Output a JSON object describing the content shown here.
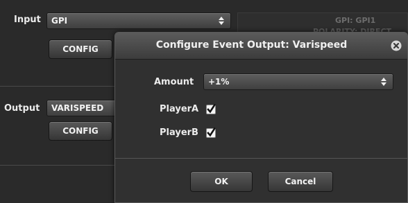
{
  "input": {
    "label": "Input",
    "value": "GPI",
    "config_label": "CONFIG",
    "info_line1": "GPI: GPI1",
    "info_line2": "POLARITY: DIRECT"
  },
  "output": {
    "label": "Output",
    "value": "VARISPEED",
    "config_label": "CONFIG"
  },
  "dialog": {
    "title": "Configure Event Output: Varispeed",
    "amount_label": "Amount",
    "amount_value": "+1%",
    "players": [
      {
        "label": "PlayerA",
        "checked": true
      },
      {
        "label": "PlayerB",
        "checked": true
      }
    ],
    "ok_label": "OK",
    "cancel_label": "Cancel"
  },
  "colors": {
    "background": "#2a2a2a",
    "dialog_bg": "#303030",
    "checkbox": "#f4f4f4"
  }
}
